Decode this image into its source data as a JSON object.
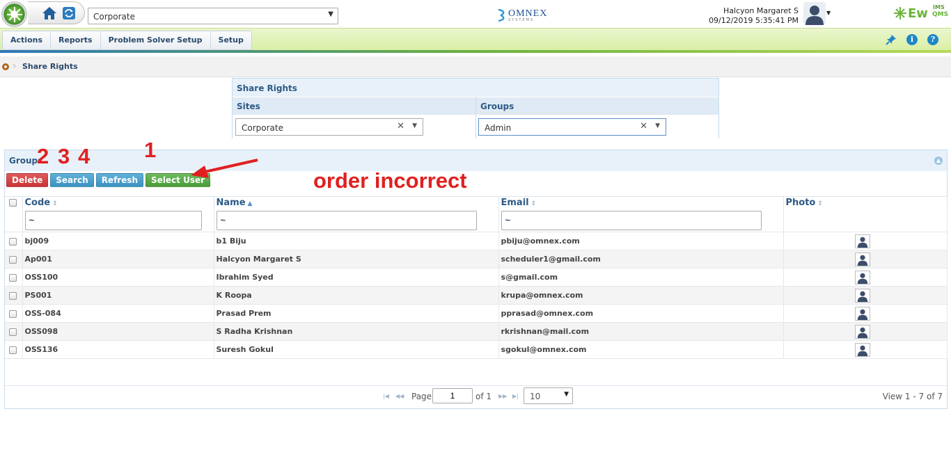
{
  "topbar": {
    "site_selected": "Corporate",
    "brand": "OMNEX",
    "brand_sub": "SYSTEMS",
    "user_name": "Halcyon Margaret S",
    "datetime": "09/12/2019 5:35:41 PM",
    "app_logo": {
      "ew": "Ew",
      "ims": "IMS",
      "qms": "QMS"
    }
  },
  "menu": {
    "items": [
      "Actions",
      "Reports",
      "Problem Solver Setup",
      "Setup"
    ],
    "right_icons": [
      "pin-icon",
      "info-icon",
      "help-icon"
    ]
  },
  "breadcrumb": {
    "current": "Share Rights"
  },
  "share_rights": {
    "title": "Share Rights",
    "sites_label": "Sites",
    "groups_label": "Groups",
    "sites_value": "Corporate",
    "groups_value": "Admin"
  },
  "grid": {
    "title": "Groups",
    "buttons": {
      "delete": "Delete",
      "search": "Search",
      "refresh": "Refresh",
      "select_user": "Select User"
    },
    "columns": {
      "code": "Code",
      "name": "Name",
      "email": "Email",
      "photo": "Photo"
    },
    "filter_placeholder": "~",
    "rows": [
      {
        "code": "bj009",
        "name": "b1 Biju",
        "email": "pbiju@omnex.com"
      },
      {
        "code": "Ap001",
        "name": "Halcyon Margaret  S",
        "email": "scheduler1@gmail.com"
      },
      {
        "code": "OSS100",
        "name": "Ibrahim Syed",
        "email": "s@gmail.com"
      },
      {
        "code": "PS001",
        "name": "K Roopa",
        "email": "krupa@omnex.com"
      },
      {
        "code": "OSS-084",
        "name": "Prasad Prem",
        "email": "pprasad@omnex.com"
      },
      {
        "code": "OSS098",
        "name": "S Radha Krishnan",
        "email": "rkrishnan@mail.com"
      },
      {
        "code": "OSS136",
        "name": "Suresh Gokul",
        "email": "sgokul@omnex.com"
      }
    ],
    "pager": {
      "page_label": "Page",
      "page_value": "1",
      "of_label": "of 1",
      "page_size": "10",
      "view_text": "View 1 - 7 of 7"
    }
  },
  "annotations": {
    "num_1": "1",
    "num_2": "2",
    "num_3": "3",
    "num_4": "4",
    "note": "order incorrect",
    "color": "#e02020"
  }
}
